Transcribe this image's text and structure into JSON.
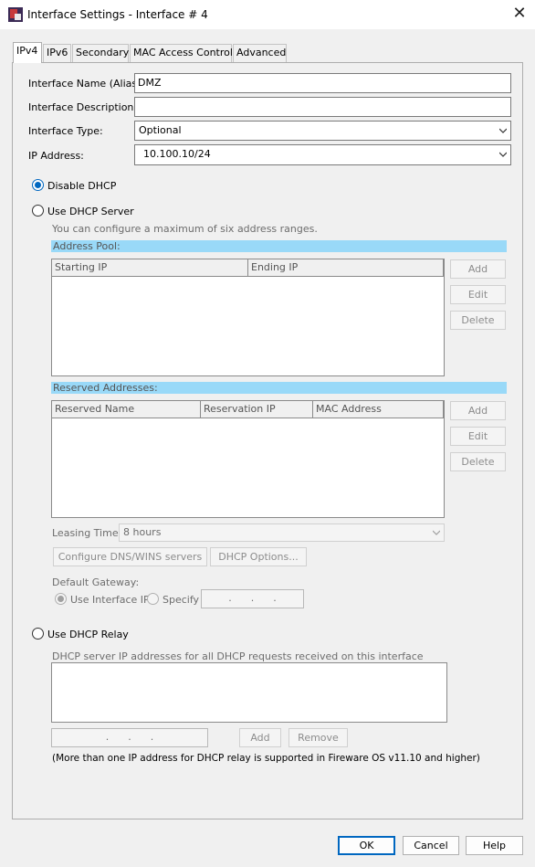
{
  "window": {
    "title": "Interface Settings - Interface # 4",
    "close_glyph": "✕"
  },
  "tabs": [
    "IPv4",
    "IPv6",
    "Secondary",
    "MAC Access Control",
    "Advanced"
  ],
  "form": {
    "name_label": "Interface Name (Alias):",
    "name_value": "DMZ",
    "description_label": "Interface Description:",
    "description_value": "",
    "type_label": "Interface Type:",
    "type_value": "Optional",
    "ip_label": "IP Address:",
    "ip_value": "10.100.10/24"
  },
  "dhcp": {
    "disable_label": "Disable DHCP",
    "disable_selected": true,
    "server_label": "Use DHCP Server",
    "server_note": "You can configure a maximum of six address ranges.",
    "address_pool_label": "Address Pool:",
    "pool_columns": [
      "Starting IP",
      "Ending IP"
    ],
    "pool_buttons": {
      "add": "Add",
      "edit": "Edit",
      "delete": "Delete"
    },
    "reserved_label": "Reserved Addresses:",
    "reserved_columns": [
      "Reserved Name",
      "Reservation IP",
      "MAC Address"
    ],
    "reserved_buttons": {
      "add": "Add",
      "edit": "Edit",
      "delete": "Delete"
    },
    "leasing_label": "Leasing Time",
    "leasing_value": "8 hours",
    "dns_button": "Configure DNS/WINS servers",
    "options_button": "DHCP Options...",
    "gateway_label": "Default Gateway:",
    "gateway_interface_label": "Use Interface IP",
    "gateway_specify_label": "Specify",
    "gateway_ip_placeholder": ".      .      .",
    "relay_label": "Use DHCP Relay",
    "relay_note": "DHCP server IP addresses for all DHCP requests received on this interface",
    "relay_ip_placeholder": ".      .      .",
    "relay_add": "Add",
    "relay_remove": "Remove",
    "relay_footnote": "(More than one IP address for DHCP relay is supported in Fireware OS v11.10 and higher)"
  },
  "footer": {
    "ok": "OK",
    "cancel": "Cancel",
    "help": "Help"
  },
  "colors": {
    "accent": "#0067c0",
    "section_bar": "#99d9f8"
  }
}
